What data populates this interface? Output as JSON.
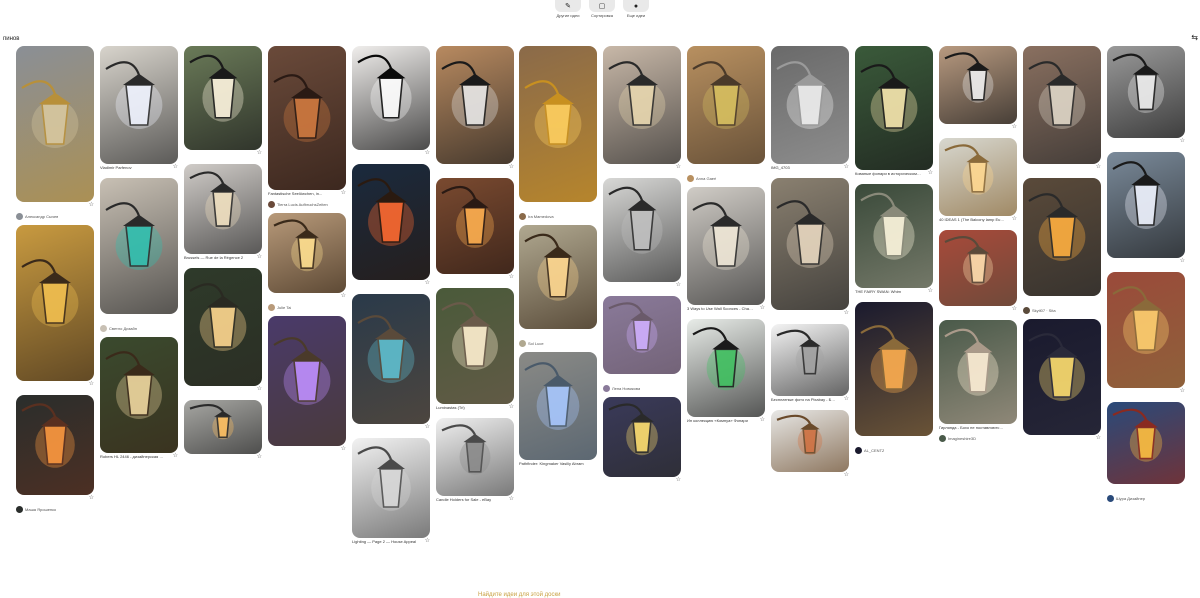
{
  "toolbar": [
    {
      "icon": "pin-icon",
      "label": "Другие идеи"
    },
    {
      "icon": "board-icon",
      "label": "Сортировка"
    },
    {
      "icon": "more-icon",
      "label": "Еще идеи"
    }
  ],
  "pin_count_label": "пинов",
  "filter_icon": "filter-icon",
  "footer_text": "Найдите идеи для этой доски",
  "columns": [
    [
      {
        "h": 156,
        "bg": "#8a8f96",
        "accent": "#b8903a",
        "glow": "#d8c8a0",
        "title": "",
        "author": "Александр Сычев",
        "star": true
      },
      {
        "h": 156,
        "bg": "#c89a40",
        "accent": "#3a2a1a",
        "glow": "#f2c050",
        "title": "",
        "author": "",
        "star": true
      },
      {
        "h": 100,
        "bg": "#2a2e2c",
        "accent": "#5a3020",
        "glow": "#ff9a40",
        "title": "",
        "author": "Маша Ярошенко",
        "star": true
      }
    ],
    [
      {
        "h": 118,
        "bg": "#d8d4cc",
        "accent": "#2a2a2a",
        "glow": "#f0f4ff",
        "title": "Vladimir Parfenov",
        "author": "",
        "star": true
      },
      {
        "h": 136,
        "bg": "#c8c0b4",
        "accent": "#2a2a2a",
        "glow": "#30c0b0",
        "title": "",
        "author": "Светло Дизайн",
        "star": false
      },
      {
        "h": 116,
        "bg": "#3a4a2e",
        "accent": "#3a2a1a",
        "glow": "#f0d8a0",
        "title": "Robers HL 2446 - дизайнерская мебель и...",
        "author": "",
        "star": true
      }
    ],
    [
      {
        "h": 104,
        "bg": "#6a7a58",
        "accent": "#1a1a1a",
        "glow": "#fff6e0",
        "title": "",
        "author": "",
        "star": true
      },
      {
        "h": 90,
        "bg": "#d0ccc8",
        "accent": "#2a2a2a",
        "glow": "#f0e0c0",
        "title": "Brussels — Rue de la Régence 2",
        "author": "",
        "star": true
      },
      {
        "h": 118,
        "bg": "#2e3a2a",
        "accent": "#2a2a22",
        "glow": "#ffd890",
        "title": "",
        "author": "",
        "star": true
      },
      {
        "h": 54,
        "bg": "#a8a8a4",
        "accent": "#2a2a2a",
        "glow": "#ffc060",
        "title": "",
        "author": "",
        "star": true
      }
    ],
    [
      {
        "h": 144,
        "bg": "#6a4a3a",
        "accent": "#2a1a14",
        "glow": "#d07a40",
        "title": "Fantastische Seelöwchen, in...",
        "author": "Tierra Lucis AufbruchsZeiten",
        "star": true
      },
      {
        "h": 80,
        "bg": "#b89a7a",
        "accent": "#3a2a1a",
        "glow": "#ffe090",
        "title": "",
        "author": "Julie Tai",
        "star": true
      },
      {
        "h": 130,
        "bg": "#4a3a6a",
        "accent": "#4a3a2a",
        "glow": "#c090ff",
        "title": "",
        "author": "",
        "star": true
      }
    ],
    [
      {
        "h": 104,
        "bg": "#f0eeec",
        "accent": "#0a0a0a",
        "glow": "#ffffff",
        "title": "",
        "author": "",
        "star": true
      },
      {
        "h": 116,
        "bg": "#1a2a3e",
        "accent": "#2a1a10",
        "glow": "#ff6a30",
        "title": "",
        "author": "",
        "star": true
      },
      {
        "h": 130,
        "bg": "#2a3a4a",
        "accent": "#5a4a3a",
        "glow": "#60c0d0",
        "title": "",
        "author": "",
        "star": true
      },
      {
        "h": 100,
        "bg": "#f2f2f2",
        "accent": "#4a4a4a",
        "glow": "#d8d8d8",
        "title": "Lighting — Page 2 — House Appeal",
        "author": "",
        "star": true
      }
    ],
    [
      {
        "h": 118,
        "bg": "#b88a60",
        "accent": "#1a1a1a",
        "glow": "#e8e8e8",
        "title": "",
        "author": "",
        "star": true
      },
      {
        "h": 96,
        "bg": "#7a4a30",
        "accent": "#2a1a14",
        "glow": "#ffb050",
        "title": "",
        "author": "",
        "star": true
      },
      {
        "h": 116,
        "bg": "#4a5a3a",
        "accent": "#6a5a4a",
        "glow": "#fff0d0",
        "title": "Luminastas (Tri)",
        "author": "",
        "star": true
      },
      {
        "h": 78,
        "bg": "#f0f0f0",
        "accent": "#4a4a4a",
        "glow": "#8a8a8a",
        "title": "Candle Holders for Sale - eBay",
        "author": "",
        "star": true
      }
    ],
    [
      {
        "h": 156,
        "bg": "#8a6a4a",
        "accent": "#c89020",
        "glow": "#ffd060",
        "title": "",
        "author": "Ira Mamedova",
        "star": false
      },
      {
        "h": 104,
        "bg": "#b0a890",
        "accent": "#3a2a1a",
        "glow": "#ffd890",
        "title": "",
        "author": "Sol Luce",
        "star": false
      },
      {
        "h": 108,
        "bg": "#8a8a86",
        "accent": "#4a5a6a",
        "glow": "#a8c8ff",
        "title": "Pathfinder: Kingmaker Vasiliy Abram",
        "author": "",
        "star": false
      }
    ],
    [
      {
        "h": 118,
        "bg": "#c8b8a8",
        "accent": "#2a2a2a",
        "glow": "#e8d8b0",
        "title": "",
        "author": "",
        "star": true
      },
      {
        "h": 104,
        "bg": "#d8d8d6",
        "accent": "#2a2a2a",
        "glow": "#c0c0c0",
        "title": "",
        "author": "",
        "star": true
      },
      {
        "h": 78,
        "bg": "#8a7a9a",
        "accent": "#6a5a6a",
        "glow": "#d0b0ff",
        "title": "",
        "author": "Лена Новикова",
        "star": false
      },
      {
        "h": 80,
        "bg": "#3a3a5a",
        "accent": "#2a2a2a",
        "glow": "#ffe070",
        "title": "",
        "author": "",
        "star": true
      }
    ],
    [
      {
        "h": 118,
        "bg": "#b89060",
        "accent": "#4a3a2a",
        "glow": "#d8c060",
        "title": "",
        "author": "Anna Gaert",
        "star": false
      },
      {
        "h": 118,
        "bg": "#d0ccc6",
        "accent": "#2a2a2a",
        "glow": "#f0e8d8",
        "title": "3 Ways to Use Wall Sconces - ChateauDecor.com",
        "author": "",
        "star": true
      },
      {
        "h": 98,
        "bg": "#e8ece8",
        "accent": "#1a1a1a",
        "glow": "#40c060",
        "title": "Ин коллекцию «Комнуа» Фонари",
        "author": "",
        "star": true
      }
    ],
    [
      {
        "h": 118,
        "bg": "#6a6a6a",
        "accent": "#9a9a9a",
        "glow": "#f0f0f0",
        "title": "IMG_4703",
        "author": "",
        "star": true
      },
      {
        "h": 132,
        "bg": "#8a8070",
        "accent": "#2a2a2a",
        "glow": "#e8d8c0",
        "title": "",
        "author": "",
        "star": true
      },
      {
        "h": 72,
        "bg": "#f4f4f4",
        "accent": "#2a2a2a",
        "glow": "#a0a0a0",
        "title": "Бесплатные фото на Pixabay - Бесплатные бумажн...",
        "author": "",
        "star": true
      },
      {
        "h": 62,
        "bg": "#e8e8e6",
        "accent": "#6a4a2a",
        "glow": "#d07040",
        "title": "",
        "author": "",
        "star": true
      }
    ],
    [
      {
        "h": 124,
        "bg": "#3a5a3a",
        "accent": "#1a1a1a",
        "glow": "#f8e8b0",
        "title": "Кованые фонари в историческом районе",
        "author": "",
        "star": true
      },
      {
        "h": 104,
        "bg": "#3a4a3a",
        "accent": "#8a8a7a",
        "glow": "#fff8e0",
        "title": "THE FAIRY SWAN: Whim",
        "author": "",
        "star": true
      },
      {
        "h": 134,
        "bg": "#1a1a2e",
        "accent": "#8a6a3a",
        "glow": "#ffb050",
        "title": "",
        "author": "AL_CENTZ",
        "star": false
      }
    ],
    [
      {
        "h": 78,
        "bg": "#b89a80",
        "accent": "#1a1a1a",
        "glow": "#f0f0f0",
        "title": "",
        "author": "",
        "star": true
      },
      {
        "h": 78,
        "bg": "#d8d8d0",
        "accent": "#8a6a3a",
        "glow": "#ffd890",
        "title": "40 IDEAS 1 (The Balcony lamp European Garden wide wall...",
        "author": "",
        "star": true
      },
      {
        "h": 76,
        "bg": "#a84a3a",
        "accent": "#5a4a3a",
        "glow": "#ffe0b0",
        "title": "",
        "author": "",
        "star": true
      },
      {
        "h": 104,
        "bg": "#4a5a4a",
        "accent": "#aa9a8a",
        "glow": "#fff0d8",
        "title": "Гирлянда - Бохо не поставляются | Подробне...",
        "author": "Imagineshire3D",
        "star": false
      }
    ],
    [
      {
        "h": 118,
        "bg": "#8a7060",
        "accent": "#2a2a2a",
        "glow": "#e0d8c8",
        "title": "",
        "author": "",
        "star": true
      },
      {
        "h": 118,
        "bg": "#5a4a3a",
        "accent": "#2a2a2a",
        "glow": "#ffb040",
        "title": "",
        "author": "Skytl07 · Sita",
        "star": false
      },
      {
        "h": 116,
        "bg": "#1a1a2e",
        "accent": "#2a2a3a",
        "glow": "#ffe070",
        "title": "",
        "author": "",
        "star": true
      }
    ],
    [
      {
        "h": 92,
        "bg": "#9a9a9a",
        "accent": "#1a1a1a",
        "glow": "#f0f0f0",
        "title": "",
        "author": "",
        "star": true
      },
      {
        "h": 106,
        "bg": "#7a8a9a",
        "accent": "#1a1a1a",
        "glow": "#f0f4ff",
        "title": "",
        "author": "",
        "star": true
      },
      {
        "h": 116,
        "bg": "#9a4a3a",
        "accent": "#8a6a3a",
        "glow": "#ffd070",
        "title": "",
        "author": "",
        "star": true
      },
      {
        "h": 82,
        "bg": "#2a4a7a",
        "accent": "#8a2a20",
        "glow": "#ffc040",
        "title": "",
        "author": "Шура Дизайнер",
        "star": false
      }
    ]
  ]
}
